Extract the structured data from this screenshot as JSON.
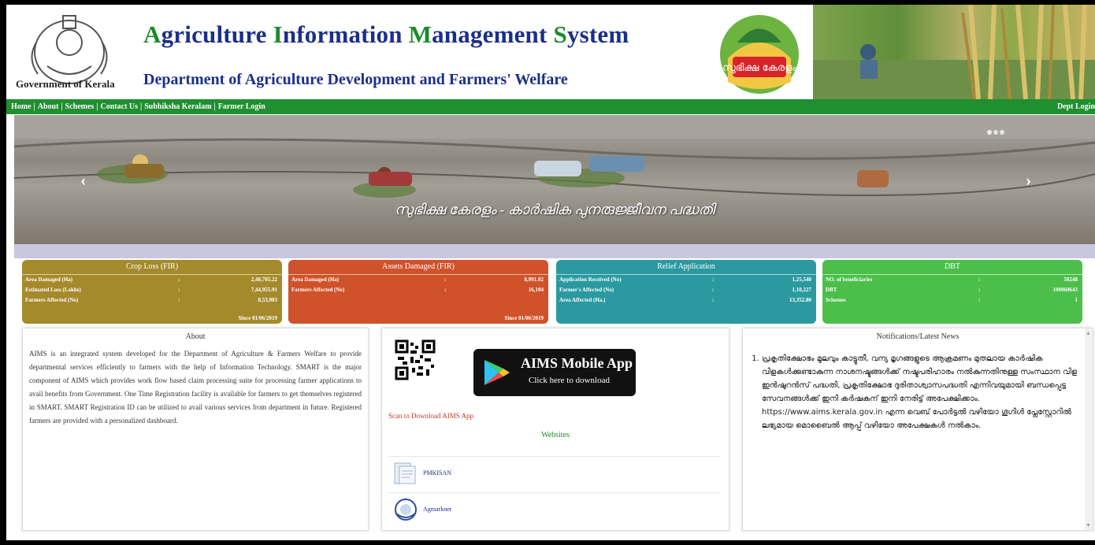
{
  "header": {
    "gov_label": "Government of Kerala",
    "title_parts": [
      {
        "text": "A",
        "hl": true
      },
      {
        "text": "griculture ",
        "hl": false
      },
      {
        "text": "I",
        "hl": true
      },
      {
        "text": "nformation ",
        "hl": false
      },
      {
        "text": "M",
        "hl": true
      },
      {
        "text": "anagement ",
        "hl": false
      },
      {
        "text": "S",
        "hl": true
      },
      {
        "text": "ystem",
        "hl": false
      }
    ],
    "subtitle": "Department of Agriculture Development and Farmers' Welfare",
    "subhiksha_logo_text": "സുഭിക്ഷ കേരളം"
  },
  "nav": {
    "items": [
      "Home",
      "About",
      "Schemes",
      "Contact Us",
      "Subhiksha Keralam",
      "Farmer Login"
    ],
    "separator": "|",
    "dept_login": "Dept Login"
  },
  "banner": {
    "caption": "സുഭിക്ഷ കേരളം - കാർഷിക പുനരുജ്ജീവന പദ്ധതി",
    "prev": "‹",
    "next": "›",
    "slides": 3,
    "active_slide": 1
  },
  "cards": [
    {
      "title": "Crop Loss (FIR)",
      "color": "#a58a2b",
      "rows": [
        {
          "label": "Area Damaged (Ha)",
          "value": "2,40,705.22"
        },
        {
          "label": "Estimated Loss (Lakhs)",
          "value": "7,44,955.91"
        },
        {
          "label": "Farmers Affected (No)",
          "value": "8,53,983"
        }
      ],
      "since": "Since 01/06/2019"
    },
    {
      "title": "Assets Damaged (FIR)",
      "color": "#d0522b",
      "rows": [
        {
          "label": "Area Damaged (Ha)",
          "value": "8,991.92"
        },
        {
          "label": "Farmers Affected (No)",
          "value": "16,104"
        }
      ],
      "since": "Since 01/06/2019"
    },
    {
      "title": "Relief Application",
      "color": "#2a9aa0",
      "rows": [
        {
          "label": "Application Received (No)",
          "value": "1,25,540"
        },
        {
          "label": "Farmer's Affected (No)",
          "value": "1,10,227"
        },
        {
          "label": "Area Affected (Ha.)",
          "value": "13,352.80"
        }
      ],
      "since": ""
    },
    {
      "title": "DBT",
      "color": "#4cbf4a",
      "rows": [
        {
          "label": "NO. of beneficiaries",
          "value": "58248"
        },
        {
          "label": "DBT",
          "value": "100060643"
        },
        {
          "label": "Schemes",
          "value": "1"
        }
      ],
      "since": ""
    }
  ],
  "colon": ":",
  "about": {
    "title": "About",
    "text": "AIMS is an integrated system developed for the Department of Agriculture & Farmers Welfare to provide departmental services efficiently to farmers with the help of Information Technology. SMART is the major component of AIMS which provides work flow based claim processing suite for processing farmer applications to avail benefits from Government. One Time Registration facility is available for farmers to get themselves registered in SMART. SMART Registration ID can be utilized to avail various services from department in future. Registered farmers are provided with a personalized dashboard."
  },
  "app": {
    "button_title": "AIMS Mobile App",
    "button_sub": "Click here to download",
    "scan_text": "Scan to Download AIMS App",
    "websites_title": "Websites",
    "sites": [
      "PMKISAN",
      "Agmarknet"
    ]
  },
  "news": {
    "title": "Notifications/Latest News",
    "items": [
      "പ്രകൃതിക്ഷോഭം മൂലവും കാട്ടുതീ, വന്യ മൃഗങ്ങളുടെ ആക്രമണം മുതലായ കാർഷിക വിളകൾക്കുണ്ടാകുന്ന നാശനഷ്ടങ്ങൾക്ക് നഷ്ടപരിഹാരം നൽകുന്നതിനുള്ള സംസ്ഥാന വിള ഇൻഷുറൻസ് പദ്ധതി, പ്രകൃതിക്ഷോഭ ദുരിതാശ്വാസപദ്ധതി എന്നിവയുമായി ബന്ധപ്പെട്ട സേവനങ്ങൾക്ക് ഇനി കർഷകന് ഇനി നേരിട്ട് അപേക്ഷിക്കാം. https://www.aims.kerala.gov.in എന്ന വെബ് പോർട്ടൽ വഴിയോ ഗൂഗിൾ പ്ലേസ്റ്റോറിൽ ലഭ്യമായ മൊബൈൽ ആപ്പ് വഴിയോ അപേക്ഷകൾ നൽകാം."
    ]
  }
}
